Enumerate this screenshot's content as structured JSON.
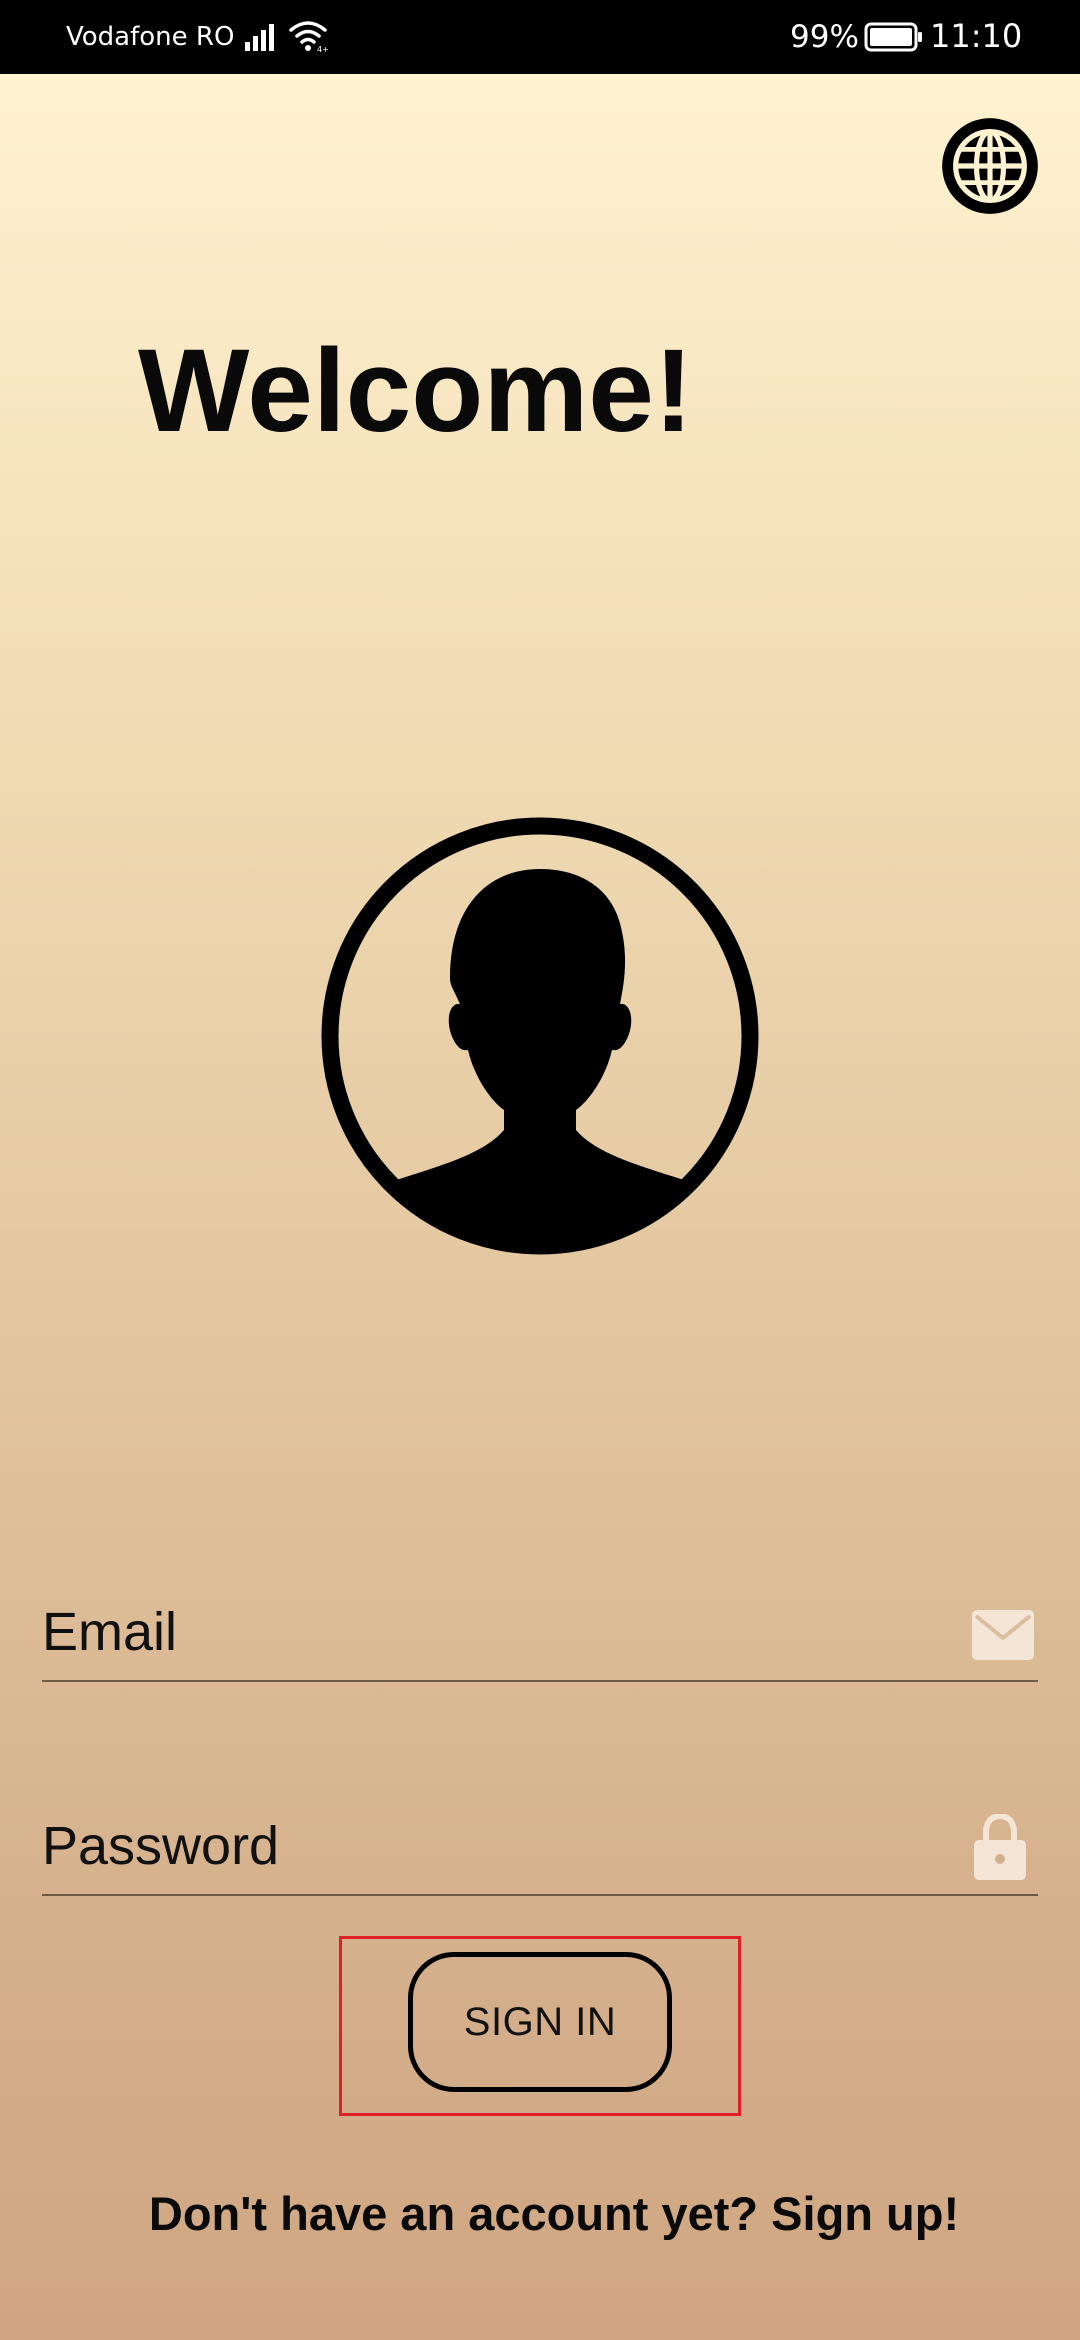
{
  "status_bar": {
    "carrier": "Vodafone RO",
    "battery_percent": "99%",
    "time": "11:10",
    "icons": [
      "signal-icon",
      "wifi-icon",
      "battery-icon"
    ]
  },
  "header": {
    "language_icon": "globe-icon",
    "title": "Welcome!"
  },
  "avatar": {
    "icon": "user-silhouette-icon"
  },
  "form": {
    "email_placeholder": "Email",
    "email_icon": "envelope-icon",
    "password_placeholder": "Password",
    "password_icon": "lock-icon",
    "sign_in_label": "SIGN IN"
  },
  "footer": {
    "signup_text": "Don't have an account yet? Sign up!"
  },
  "colors": {
    "background_top": "#fff2d0",
    "background_bottom": "#cfa681",
    "highlight_box": "#e01e25",
    "field_icon": "#f3e6d6"
  }
}
